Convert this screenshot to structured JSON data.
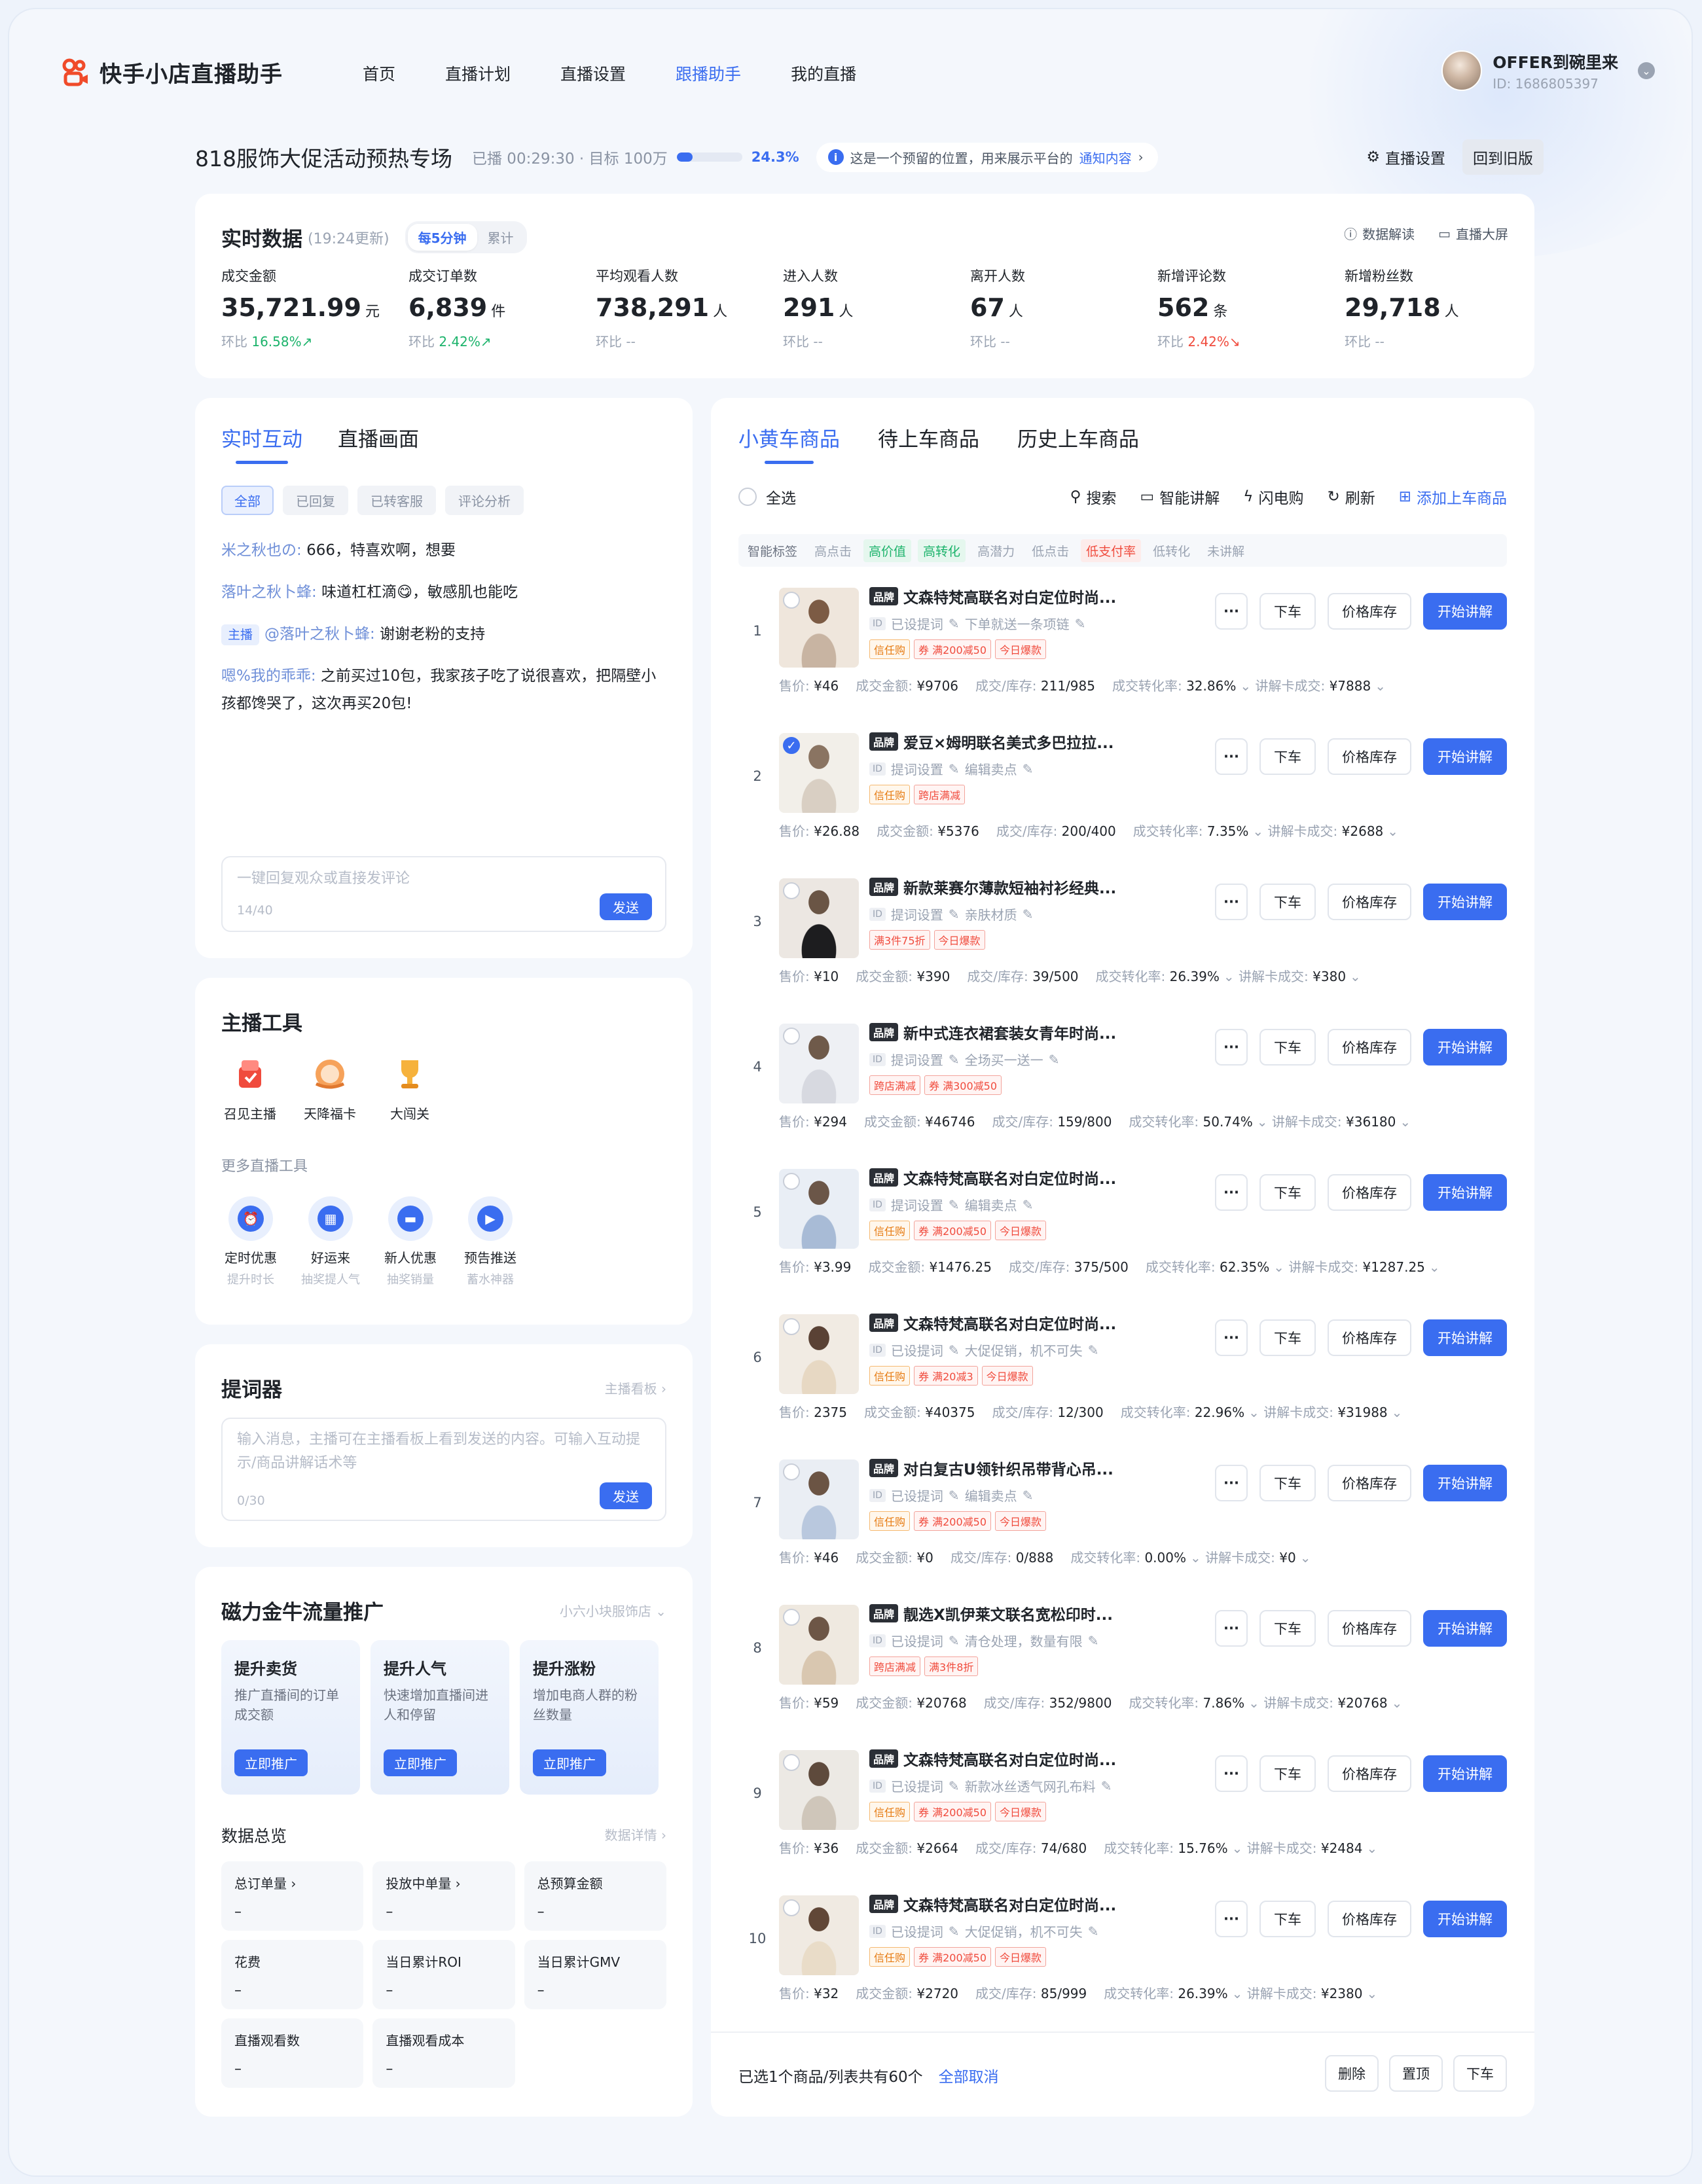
{
  "app": {
    "name": "快手小店直播助手",
    "brand_color": "#f04b2a",
    "accent": "#3a6df0"
  },
  "nav": {
    "items": [
      {
        "label": "首页",
        "active": false
      },
      {
        "label": "直播计划",
        "active": false
      },
      {
        "label": "直播设置",
        "active": false
      },
      {
        "label": "跟播助手",
        "active": true
      },
      {
        "label": "我的直播",
        "active": false
      }
    ]
  },
  "user": {
    "name": "OFFER到碗里来",
    "id": "ID: 1686805397"
  },
  "live": {
    "title": "818服饰大促活动预热专场",
    "meta": "已播 00:29:30 · 目标 100万",
    "progress_pct": 24.3,
    "progress_label": "24.3%",
    "notice_text": "这是一个预留的位置，用来展示平台的",
    "notice_link": "通知内容",
    "settings_label": "直播设置",
    "back_label": "回到旧版"
  },
  "realtime": {
    "title": "实时数据",
    "updated": "(19:24更新)",
    "seg": [
      "每5分钟",
      "累计"
    ],
    "actions": [
      "数据解读",
      "直播大屏"
    ],
    "metrics": [
      {
        "label": "成交金额",
        "value": "35,721.99",
        "unit": "元",
        "delta_prefix": "环比",
        "delta": "16.58%",
        "trend": "up"
      },
      {
        "label": "成交订单数",
        "value": "6,839",
        "unit": "件",
        "delta_prefix": "环比",
        "delta": "2.42%",
        "trend": "up"
      },
      {
        "label": "平均观看人数",
        "value": "738,291",
        "unit": "人",
        "delta_prefix": "环比",
        "delta": "--",
        "trend": "none"
      },
      {
        "label": "进入人数",
        "value": "291",
        "unit": "人",
        "delta_prefix": "环比",
        "delta": "--",
        "trend": "none"
      },
      {
        "label": "离开人数",
        "value": "67",
        "unit": "人",
        "delta_prefix": "环比",
        "delta": "--",
        "trend": "none"
      },
      {
        "label": "新增评论数",
        "value": "562",
        "unit": "条",
        "delta_prefix": "环比",
        "delta": "2.42%",
        "trend": "down"
      },
      {
        "label": "新增粉丝数",
        "value": "29,718",
        "unit": "人",
        "delta_prefix": "环比",
        "delta": "--",
        "trend": "none"
      }
    ]
  },
  "interact": {
    "tabs": [
      "实时互动",
      "直播画面"
    ],
    "filters": [
      "全部",
      "已回复",
      "已转客服",
      "评论分析"
    ],
    "comments": [
      {
        "badge": "",
        "nick": "米之秋也の:",
        "text": "666，特喜欢啊，想要"
      },
      {
        "badge": "",
        "nick": "落叶之秋卜蜂:",
        "text": "味道杠杠滴😋，敏感肌也能吃"
      },
      {
        "badge": "主播",
        "nick": "@落叶之秋卜蜂:",
        "text": "谢谢老粉的支持"
      },
      {
        "badge": "",
        "nick": "嗯%我的乖乖:",
        "text": "之前买过10包，我家孩子吃了说很喜欢，把隔壁小孩都馋哭了，这次再买20包!"
      }
    ],
    "reply_placeholder": "一键回复观众或直接发评论",
    "reply_count": "14/40",
    "send": "发送"
  },
  "tools": {
    "title": "主播工具",
    "main": [
      {
        "label": "召见主播",
        "icon": "summon-icon"
      },
      {
        "label": "天降福卡",
        "icon": "lucky-card-icon"
      },
      {
        "label": "大闯关",
        "icon": "trophy-icon"
      }
    ],
    "more_label": "更多直播工具",
    "more": [
      {
        "label": "定时优惠",
        "sub": "提升时长",
        "icon": "alarm-icon"
      },
      {
        "label": "好运来",
        "sub": "抽奖提人气",
        "icon": "calendar-icon"
      },
      {
        "label": "新人优惠",
        "sub": "抽奖销量",
        "icon": "ticket-icon"
      },
      {
        "label": "预告推送",
        "sub": "蓄水神器",
        "icon": "video-icon"
      }
    ]
  },
  "prompter": {
    "title": "提词器",
    "link": "主播看板 ›",
    "placeholder": "输入消息，主播可在主播看板上看到发送的内容。可输入互动提示/商品讲解话术等",
    "count": "0/30",
    "send": "发送"
  },
  "promo": {
    "title": "磁力金牛流量推广",
    "shop": "小六小块服饰店 ⌄",
    "cards": [
      {
        "title": "提升卖货",
        "desc": "推广直播间的订单成交额",
        "btn": "立即推广"
      },
      {
        "title": "提升人气",
        "desc": "快速增加直播间进人和停留",
        "btn": "立即推广"
      },
      {
        "title": "提升涨粉",
        "desc": "增加电商人群的粉丝数量",
        "btn": "立即推广"
      }
    ],
    "overview_title": "数据总览",
    "overview_link": "数据详情 ›",
    "stats": [
      {
        "label": "总订单量 ›",
        "value": "–"
      },
      {
        "label": "投放中单量 ›",
        "value": "–"
      },
      {
        "label": "总预算金额",
        "value": "–"
      },
      {
        "label": "花费",
        "value": "–"
      },
      {
        "label": "当日累计ROI",
        "value": "–"
      },
      {
        "label": "当日累计GMV",
        "value": "–"
      },
      {
        "label": "直播观看数",
        "value": "–"
      },
      {
        "label": "直播观看成本",
        "value": "–"
      }
    ]
  },
  "products": {
    "tabs": [
      "小黄车商品",
      "待上车商品",
      "历史上车商品"
    ],
    "select_all": "全选",
    "actions": [
      "搜索",
      "智能讲解",
      "闪电购",
      "刷新",
      "添加上车商品"
    ],
    "smart_label": "智能标签",
    "smart_tags": [
      {
        "text": "高点击",
        "style": "plain"
      },
      {
        "text": "高价值",
        "style": "green"
      },
      {
        "text": "高转化",
        "style": "green"
      },
      {
        "text": "高潜力",
        "style": "plain"
      },
      {
        "text": "低点击",
        "style": "plain"
      },
      {
        "text": "低支付率",
        "style": "red"
      },
      {
        "text": "低转化",
        "style": "plain"
      },
      {
        "text": "未讲解",
        "style": "plain"
      }
    ],
    "row_buttons": {
      "more": "···",
      "off": "下车",
      "price": "价格库存",
      "start": "开始讲解"
    },
    "brand": "品牌",
    "items": [
      {
        "idx": "1",
        "checked": false,
        "title": "文森特梵高联名对白定位时尚...",
        "l2a": "已设提词",
        "l2b": "下单就送一条项链",
        "tags": [
          [
            "信任购",
            "orange"
          ],
          [
            "券 满200减50",
            "red"
          ],
          [
            "今日爆款",
            "red"
          ]
        ],
        "price": "¥46",
        "gmv": "¥9706",
        "stock": "211/985",
        "cvr": "32.86%",
        "card": "¥7888"
      },
      {
        "idx": "2",
        "checked": true,
        "title": "爱豆×姆明联名美式多巴拉拉...",
        "l2a": "提词设置",
        "l2b": "编辑卖点",
        "tags": [
          [
            "信任购",
            "orange"
          ],
          [
            "跨店满减",
            "red"
          ]
        ],
        "price": "¥26.88",
        "gmv": "¥5376",
        "stock": "200/400",
        "cvr": "7.35%",
        "card": "¥2688"
      },
      {
        "idx": "3",
        "checked": false,
        "title": "新款莱赛尔薄款短袖衬衫经典...",
        "l2a": "提词设置",
        "l2b": "亲肤材质",
        "tags": [
          [
            "满3件75折",
            "red"
          ],
          [
            "今日爆款",
            "red"
          ]
        ],
        "price": "¥10",
        "gmv": "¥390",
        "stock": "39/500",
        "cvr": "26.39%",
        "card": "¥380"
      },
      {
        "idx": "4",
        "checked": false,
        "title": "新中式连衣裙套装女青年时尚...",
        "l2a": "提词设置",
        "l2b": "全场买一送一",
        "tags": [
          [
            "跨店满减",
            "red"
          ],
          [
            "券 满300减50",
            "red"
          ]
        ],
        "price": "¥294",
        "gmv": "¥46746",
        "stock": "159/800",
        "cvr": "50.74%",
        "card": "¥36180"
      },
      {
        "idx": "5",
        "checked": false,
        "title": "文森特梵高联名对白定位时尚...",
        "l2a": "提词设置",
        "l2b": "编辑卖点",
        "tags": [
          [
            "信任购",
            "orange"
          ],
          [
            "券 满200减50",
            "red"
          ],
          [
            "今日爆款",
            "red"
          ]
        ],
        "price": "¥3.99",
        "gmv": "¥1476.25",
        "stock": "375/500",
        "cvr": "62.35%",
        "card": "¥1287.25"
      },
      {
        "idx": "6",
        "checked": false,
        "title": "文森特梵高联名对白定位时尚...",
        "l2a": "已设提词",
        "l2b": "大促促销，机不可失",
        "tags": [
          [
            "信任购",
            "orange"
          ],
          [
            "券 满20减3",
            "red"
          ],
          [
            "今日爆款",
            "red"
          ]
        ],
        "price": "2375",
        "gmv": "¥40375",
        "stock": "12/300",
        "cvr": "22.96%",
        "card": "¥31988"
      },
      {
        "idx": "7",
        "checked": false,
        "title": "对白复古U领针织吊带背心吊...",
        "l2a": "已设提词",
        "l2b": "编辑卖点",
        "tags": [
          [
            "信任购",
            "orange"
          ],
          [
            "券 满200减50",
            "red"
          ],
          [
            "今日爆款",
            "red"
          ]
        ],
        "price": "¥46",
        "gmv": "¥0",
        "stock": "0/888",
        "cvr": "0.00%",
        "card": "¥0"
      },
      {
        "idx": "8",
        "checked": false,
        "title": "靓选X凯伊莱文联名宽松印时...",
        "l2a": "已设提词",
        "l2b": "清仓处理，数量有限",
        "tags": [
          [
            "跨店满减",
            "red"
          ],
          [
            "满3件8折",
            "red"
          ]
        ],
        "price": "¥59",
        "gmv": "¥20768",
        "stock": "352/9800",
        "cvr": "7.86%",
        "card": "¥20768"
      },
      {
        "idx": "9",
        "checked": false,
        "title": "文森特梵高联名对白定位时尚...",
        "l2a": "已设提词",
        "l2b": "新款冰丝透气网孔布料",
        "tags": [
          [
            "信任购",
            "orange"
          ],
          [
            "券 满200减50",
            "red"
          ],
          [
            "今日爆款",
            "red"
          ]
        ],
        "price": "¥36",
        "gmv": "¥2664",
        "stock": "74/680",
        "cvr": "15.76%",
        "card": "¥2484"
      },
      {
        "idx": "10",
        "checked": false,
        "title": "文森特梵高联名对白定位时尚...",
        "l2a": "已设提词",
        "l2b": "大促促销，机不可失",
        "tags": [
          [
            "信任购",
            "orange"
          ],
          [
            "券 满200减50",
            "red"
          ],
          [
            "今日爆款",
            "red"
          ]
        ],
        "price": "¥32",
        "gmv": "¥2720",
        "stock": "85/999",
        "cvr": "26.39%",
        "card": "¥2380"
      }
    ],
    "stat_labels": {
      "price": "售价:",
      "gmv": "成交金额:",
      "stock": "成交/库存:",
      "cvr": "成交转化率:",
      "card": "讲解卡成交:"
    },
    "footer_text": "已选1个商品/列表共有60个",
    "footer_link": "全部取消",
    "footer_buttons": [
      "删除",
      "置顶",
      "下车"
    ]
  }
}
